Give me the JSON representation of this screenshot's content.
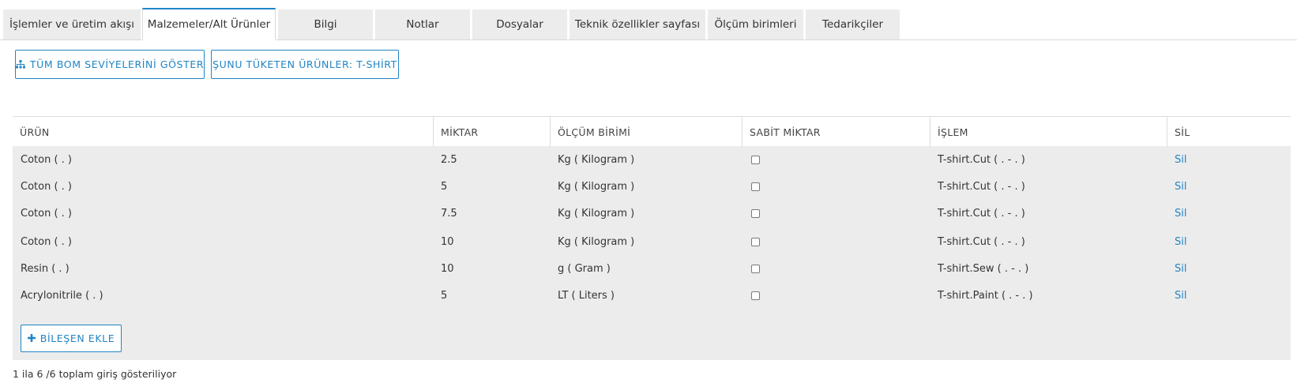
{
  "tabs": [
    {
      "label": "İşlemler ve üretim akışı",
      "active": false
    },
    {
      "label": "Malzemeler/Alt Ürünler",
      "active": true
    },
    {
      "label": "Bilgi",
      "active": false
    },
    {
      "label": "Notlar",
      "active": false
    },
    {
      "label": "Dosyalar",
      "active": false
    },
    {
      "label": "Teknik özellikler sayfası",
      "active": false
    },
    {
      "label": "Ölçüm birimleri",
      "active": false
    },
    {
      "label": "Tedarikçiler",
      "active": false
    }
  ],
  "actions": {
    "show_bom_label": "TÜM BOM SEVİYELERİNİ GÖSTER",
    "consuming_products_label": "ŞUNU TÜKETEN ÜRÜNLER: T-SHİRT",
    "add_component_label": "BİLEŞEN EKLE"
  },
  "icons": {
    "show_bom": "sitemap-icon",
    "add_component": "plus-icon"
  },
  "table": {
    "headers": [
      "ÜRÜN",
      "MİKTAR",
      "ÖLÇÜM BİRİMİ",
      "SABİT MİKTAR",
      "İŞLEM",
      "SİL"
    ],
    "rows": [
      {
        "product": "Coton ( . )",
        "quantity": "2.5",
        "unit": "Kg ( Kilogram )",
        "fixed": false,
        "operation": "T-shirt.Cut ( . - . )",
        "delete": "Sil"
      },
      {
        "product": "Coton ( . )",
        "quantity": "5",
        "unit": "Kg ( Kilogram )",
        "fixed": false,
        "operation": "T-shirt.Cut ( . - . )",
        "delete": "Sil"
      },
      {
        "product": "Coton ( . )",
        "quantity": "7.5",
        "unit": "Kg ( Kilogram )",
        "fixed": false,
        "operation": "T-shirt.Cut ( . - . )",
        "delete": "Sil"
      },
      {
        "product": "Coton ( . )",
        "quantity": "10",
        "unit": "Kg ( Kilogram )",
        "fixed": false,
        "operation": "T-shirt.Cut ( . - . )",
        "delete": "Sil"
      },
      {
        "product": "Resin ( . )",
        "quantity": "10",
        "unit": "g ( Gram )",
        "fixed": false,
        "operation": "T-shirt.Sew ( . - . )",
        "delete": "Sil"
      },
      {
        "product": "Acrylonitrile ( . )",
        "quantity": "5",
        "unit": "LT ( Liters )",
        "fixed": false,
        "operation": "T-shirt.Paint ( . - . )",
        "delete": "Sil"
      }
    ]
  },
  "footer": {
    "entries_info": "1 ila 6 /6 toplam giriş gösteriliyor"
  },
  "colors": {
    "accent": "#2185c5",
    "tab_bg": "#ececec",
    "table_bg": "#ececec"
  }
}
